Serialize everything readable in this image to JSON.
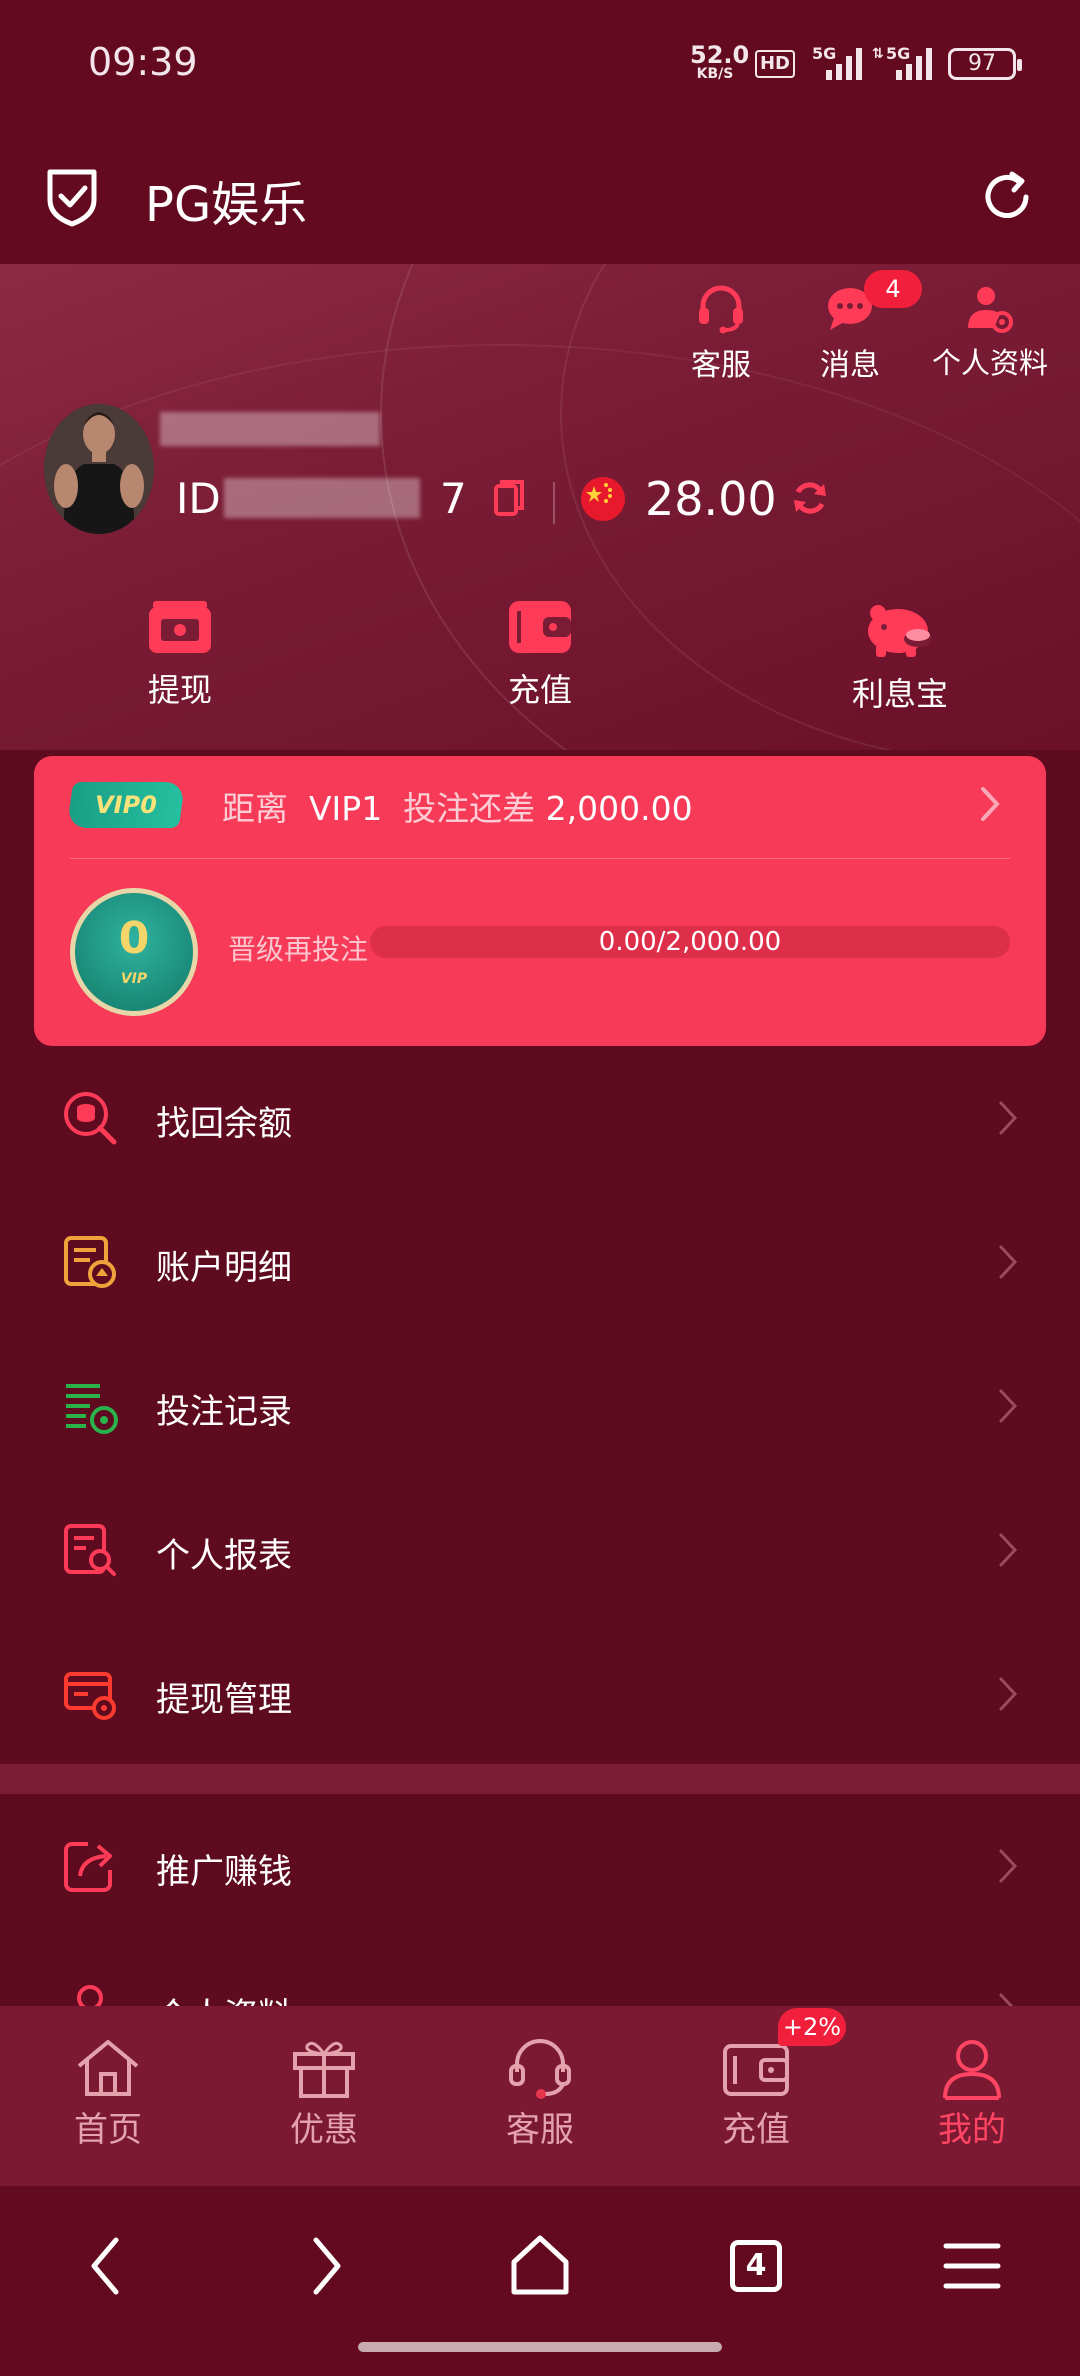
{
  "status_bar": {
    "time": "09:39",
    "net_speed_value": "52.0",
    "net_speed_unit": "KB/S",
    "hd_label": "HD",
    "signal1_label": "5G",
    "signal2_label": "5G",
    "battery": "97"
  },
  "app_bar": {
    "title": "PG娱乐",
    "shield_icon": "shield-check-icon",
    "refresh_icon": "refresh-icon"
  },
  "top_actions": {
    "service_label": "客服",
    "messages_label": "消息",
    "messages_count": "4",
    "profile_label": "个人资料"
  },
  "account": {
    "id_prefix": "ID",
    "id_suffix": "7",
    "balance": "28.00",
    "currency_flag": "cn-flag-icon"
  },
  "wallet_actions": {
    "withdraw_label": "提现",
    "deposit_label": "充值",
    "interest_label": "利息宝"
  },
  "vip": {
    "badge": "VIP0",
    "text_prefix": "距离",
    "next_level": "VIP1",
    "text_middle": "投注还差",
    "remaining": "2,000.00",
    "medal_level": "0",
    "medal_sub": "VIP",
    "progress_label": "晋级再投注",
    "progress_text": "0.00/2,000.00",
    "progress_fraction": 0.0
  },
  "menu": {
    "items": [
      {
        "label": "找回余额",
        "icon": "balance-recovery-icon"
      },
      {
        "label": "账户明细",
        "icon": "account-details-icon"
      },
      {
        "label": "投注记录",
        "icon": "bet-records-icon"
      },
      {
        "label": "个人报表",
        "icon": "personal-report-icon"
      },
      {
        "label": "提现管理",
        "icon": "withdraw-management-icon"
      }
    ],
    "items2": [
      {
        "label": "推广赚钱",
        "icon": "promotion-share-icon"
      },
      {
        "label": "个人资料",
        "icon": "profile-icon"
      }
    ]
  },
  "bottom_nav": {
    "home": "首页",
    "promo": "优惠",
    "service": "客服",
    "recharge": "充值",
    "recharge_badge": "+2%",
    "mine": "我的",
    "active": "mine",
    "accent": "#ff4563"
  },
  "system_nav": {
    "tab_count": "4"
  }
}
